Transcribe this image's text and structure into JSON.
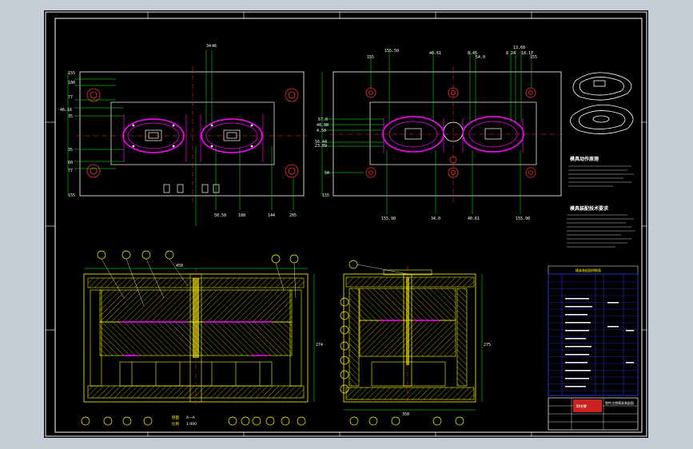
{
  "colors": {
    "background": "#000000",
    "frame": "#ffffff",
    "centerline": "#ff3333",
    "dimension": "#00ff00",
    "part": "#ff00ff",
    "hatch": "#ffff00",
    "table": "#2233cc"
  },
  "plan_left": {
    "top_dims": [
      "34",
      "46"
    ],
    "left_dims": [
      "155",
      "100",
      "77",
      "46.16",
      "35",
      "35",
      "60",
      "77",
      "155"
    ],
    "bottom_dims": [
      "50.50",
      "100",
      "144",
      "205"
    ]
  },
  "plan_right": {
    "top_dims": [
      "155",
      "155.50",
      "40.61",
      "8.45",
      "54.0",
      "8 24",
      "13.68",
      "18.17",
      "155"
    ],
    "left_dims": [
      "67.0",
      "40.08",
      "4.50",
      "16.44",
      "23.89",
      "50",
      "155"
    ],
    "bottom_dims": [
      "155.90",
      "34.0",
      "40.61",
      "155.90"
    ]
  },
  "notes": {
    "title1": "模具动作原理",
    "title2": "模具装配技术要求"
  },
  "section_views": {
    "left_scale_label": "剖面",
    "left_scale_text": "A—A",
    "left_ratio_label": "比例",
    "left_ratio": "1:000",
    "left_top_dim": "450",
    "left_side_dim": "274",
    "right_bottom_dim": "350",
    "right_side_dim": "275"
  },
  "parts_table": {
    "header": "模具装配图明细表"
  },
  "title_block": {
    "school": "XX大学",
    "drawing_title": "塑件注塑模具装配图"
  }
}
